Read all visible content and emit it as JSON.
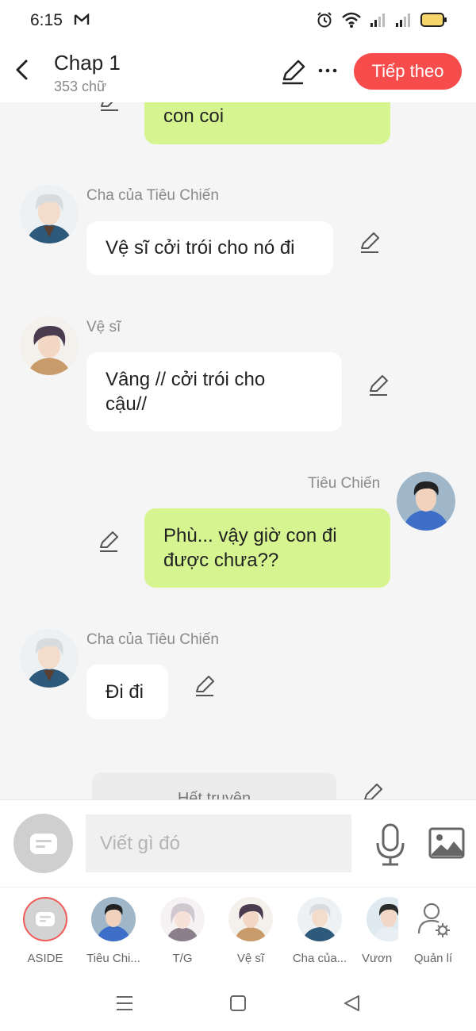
{
  "status": {
    "time": "6:15"
  },
  "header": {
    "title": "Chap 1",
    "subtitle": "353 chữ",
    "next_label": "Tiếp theo"
  },
  "messages": [
    {
      "side": "right",
      "text": "con coi"
    },
    {
      "side": "left",
      "sender": "Cha của Tiêu Chiến",
      "text": "Vệ sĩ cởi trói cho nó đi"
    },
    {
      "side": "left",
      "sender": "Vệ sĩ",
      "text_line1": "Vâng // cởi trói cho",
      "text_line2": "cậu//"
    },
    {
      "side": "right",
      "sender": "Tiêu Chiến",
      "text_line1": "Phù... vậy giờ con đi",
      "text_line2": "được chưa??"
    },
    {
      "side": "left",
      "sender": "Cha của Tiêu Chiến",
      "text": "Đi đi"
    },
    {
      "side": "center",
      "text": "Hết truyện"
    }
  ],
  "composer": {
    "placeholder": "Viết gì đó"
  },
  "characters": [
    {
      "label": "ASIDE"
    },
    {
      "label": "Tiêu Chi..."
    },
    {
      "label": "T/G"
    },
    {
      "label": "Vệ sĩ"
    },
    {
      "label": "Cha của..."
    },
    {
      "label": "Vươn"
    },
    {
      "label": "Quản lí"
    }
  ],
  "colors": {
    "accent": "#f74c4c",
    "right_bubble": "#d6f590",
    "left_bubble": "#ffffff",
    "background": "#f5f5f5"
  }
}
